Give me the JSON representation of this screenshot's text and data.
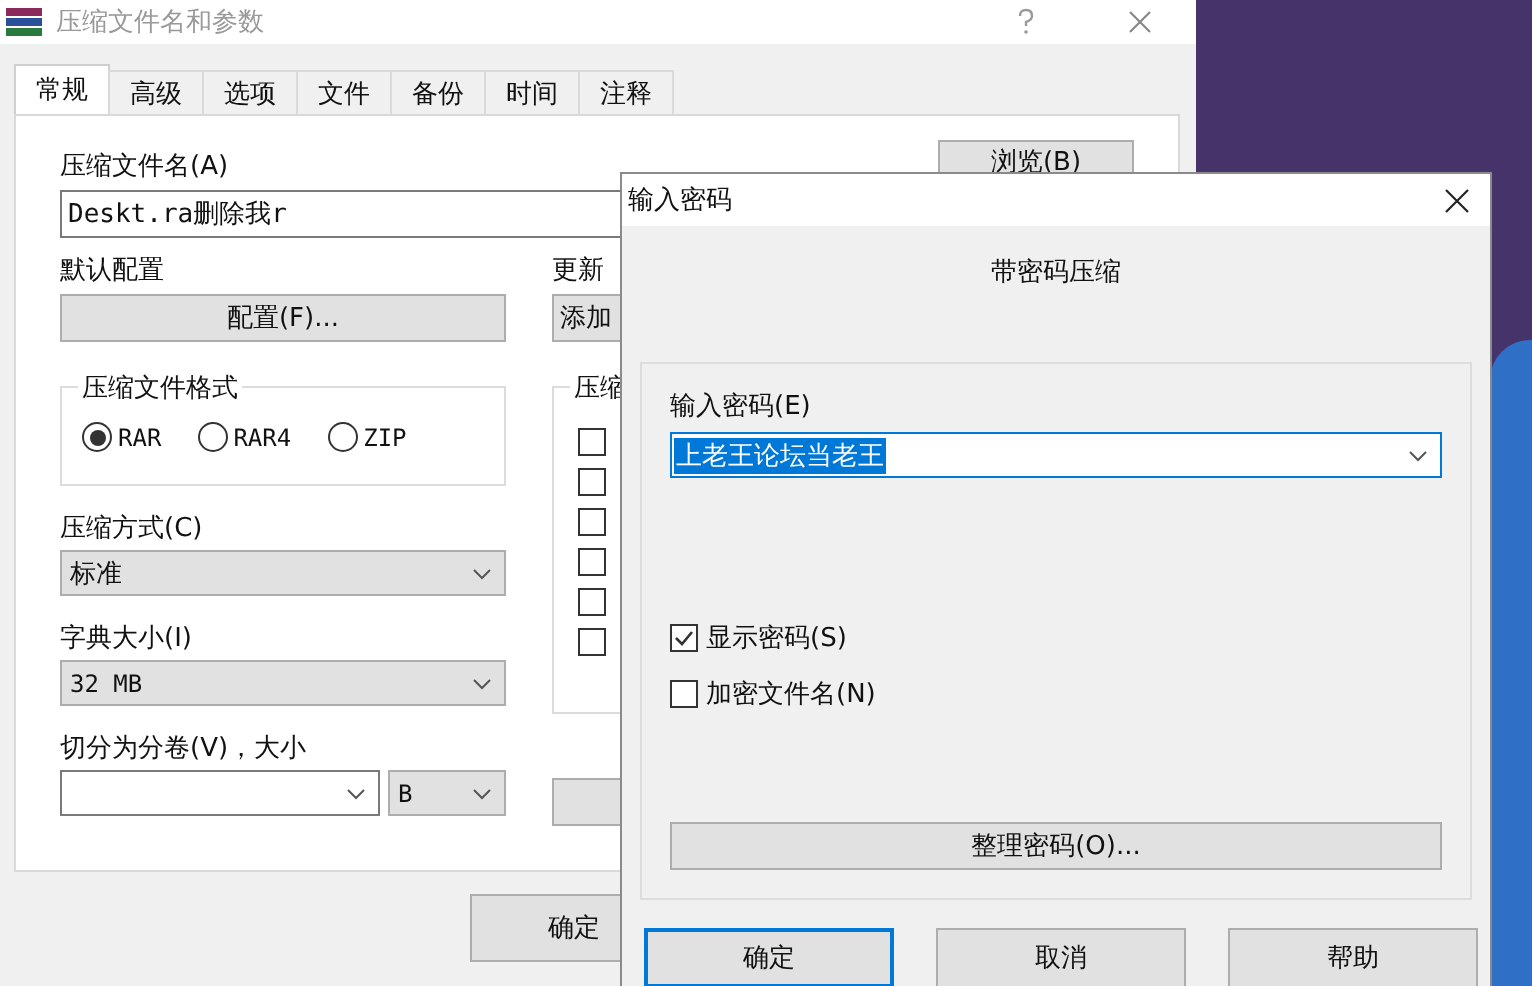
{
  "main_window": {
    "title": "压缩文件名和参数"
  },
  "tabs": [
    {
      "label": "常规",
      "selected": true
    },
    {
      "label": "高级",
      "selected": false
    },
    {
      "label": "选项",
      "selected": false
    },
    {
      "label": "文件",
      "selected": false
    },
    {
      "label": "备份",
      "selected": false
    },
    {
      "label": "时间",
      "selected": false
    },
    {
      "label": "注释",
      "selected": false
    }
  ],
  "archive_name": {
    "label": "压缩文件名(A)",
    "value": "Deskt.ra删除我r",
    "browse_button": "浏览(B)"
  },
  "profile": {
    "label": "默认配置",
    "button": "配置(F)..."
  },
  "update_mode": {
    "label": "更新",
    "button": "添加"
  },
  "format": {
    "legend": "压缩文件格式",
    "options": [
      {
        "label": "RAR",
        "selected": true
      },
      {
        "label": "RAR4",
        "selected": false
      },
      {
        "label": "ZIP",
        "selected": false
      }
    ]
  },
  "method": {
    "label": "压缩方式(C)",
    "value": "标准"
  },
  "dictionary": {
    "label": "字典大小(I)",
    "value": "32 MB"
  },
  "volumes": {
    "label": "切分为分卷(V)，大小",
    "unit": "B"
  },
  "options_group": {
    "legend": "压缩",
    "checkboxes": [
      {
        "checked": false
      },
      {
        "checked": false
      },
      {
        "checked": false
      },
      {
        "checked": false
      },
      {
        "checked": false
      },
      {
        "checked": false
      }
    ]
  },
  "main_buttons": [
    "确定"
  ],
  "password_dialog": {
    "title": "输入密码",
    "heading": "带密码压缩",
    "password_label": "输入密码(E)",
    "password_value": "上老王论坛当老王",
    "password_selected": true,
    "checkboxes": [
      {
        "label": "显示密码(S)",
        "checked": true
      },
      {
        "label": "加密文件名(N)",
        "checked": false
      }
    ],
    "organize_button": "整理密码(O)...",
    "buttons": [
      {
        "label": "确定",
        "selected": true
      },
      {
        "label": "取消",
        "selected": false
      },
      {
        "label": "帮助",
        "selected": false
      }
    ]
  }
}
